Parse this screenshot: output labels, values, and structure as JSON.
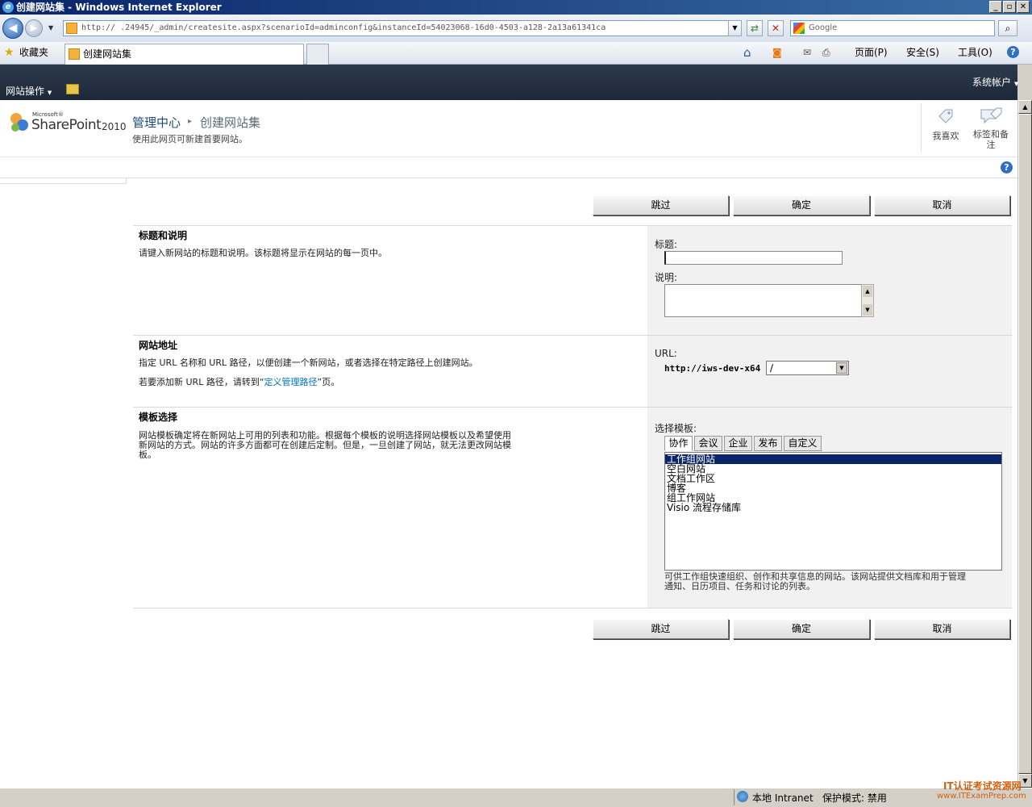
{
  "window": {
    "title": "创建网站集 - Windows Internet Explorer",
    "min_glyph": "_",
    "max_glyph": "▫",
    "close_glyph": "✕"
  },
  "nav": {
    "back_icon": "back-arrow-icon",
    "forward_icon": "forward-arrow-icon",
    "address": "http://              .24945/_admin/createsite.aspx?scenarioId=adminconfig&instanceId=54023068-16d0-4503-a128-2a13a61341ca",
    "refresh_glyph": "⇄",
    "stop_glyph": "✕",
    "search_placeholder": "Google",
    "search_glyph": "⌕"
  },
  "favbar": {
    "favorites_label": "收藏夹",
    "tab_title": "创建网站集",
    "home_glyph": "⌂",
    "rss_glyph": "◙",
    "mail_glyph": "✉",
    "print_glyph": "⎙",
    "page_menu": "页面(P)",
    "safety_menu": "安全(S)",
    "tools_menu": "工具(O)",
    "help_glyph": "?"
  },
  "ribbon": {
    "site_actions": "网站操作",
    "system_account": "系统帐户"
  },
  "header": {
    "logo_microsoft": "Microsoft®",
    "logo_sharepoint": "SharePoint",
    "logo_version": "2010",
    "breadcrumb_root": "管理中心",
    "breadcrumb_sep": "▸",
    "breadcrumb_current": "创建网站集",
    "subtitle": "使用此网页可新建首要网站。",
    "like_label": "我喜欢",
    "tags_label": "标签和备注",
    "help_glyph": "?"
  },
  "buttons": {
    "skip": "跳过",
    "ok": "确定",
    "cancel": "取消"
  },
  "sections": {
    "title_desc": {
      "heading": "标题和说明",
      "description": "请键入新网站的标题和说明。该标题将显示在网站的每一页中。",
      "title_label": "标题:",
      "title_value": "",
      "desc_label": "说明:",
      "desc_value": ""
    },
    "site_address": {
      "heading": "网站地址",
      "description1": "指定 URL 名称和 URL 路径，以便创建一个新网站，或者选择在特定路径上创建网站。",
      "description2_prefix": "若要添加新 URL 路径，请转到“",
      "description2_link": "定义管理路径",
      "description2_suffix": "”页。",
      "url_label": "URL:",
      "url_prefix": "http://iws-dev-x64",
      "path_value": "/"
    },
    "template": {
      "heading": "模板选择",
      "description": "网站模板确定将在新网站上可用的列表和功能。根据每个模板的说明选择网站模板以及希望使用新网站的方式。网站的许多方面都可在创建后定制。但是，一旦创建了网站，就无法更改网站模板。",
      "select_label": "选择模板:",
      "tabs": [
        "协作",
        "会议",
        "企业",
        "发布",
        "自定义"
      ],
      "selected_tab": "协作",
      "items": [
        "工作组网站",
        "空白网站",
        "文档工作区",
        "博客",
        "组工作网站",
        "Visio 流程存储库"
      ],
      "selected_item": "工作组网站",
      "item_description": "可供工作组快速组织、创作和共享信息的网站。该网站提供文档库和用于管理通知、日历项目、任务和讨论的列表。"
    }
  },
  "status": {
    "zone": "本地 Intranet",
    "protected_mode": "保护模式: 禁用",
    "watermark_top": "IT认证考试资源网",
    "watermark_bottom": "www.ITExamPrep.com"
  }
}
